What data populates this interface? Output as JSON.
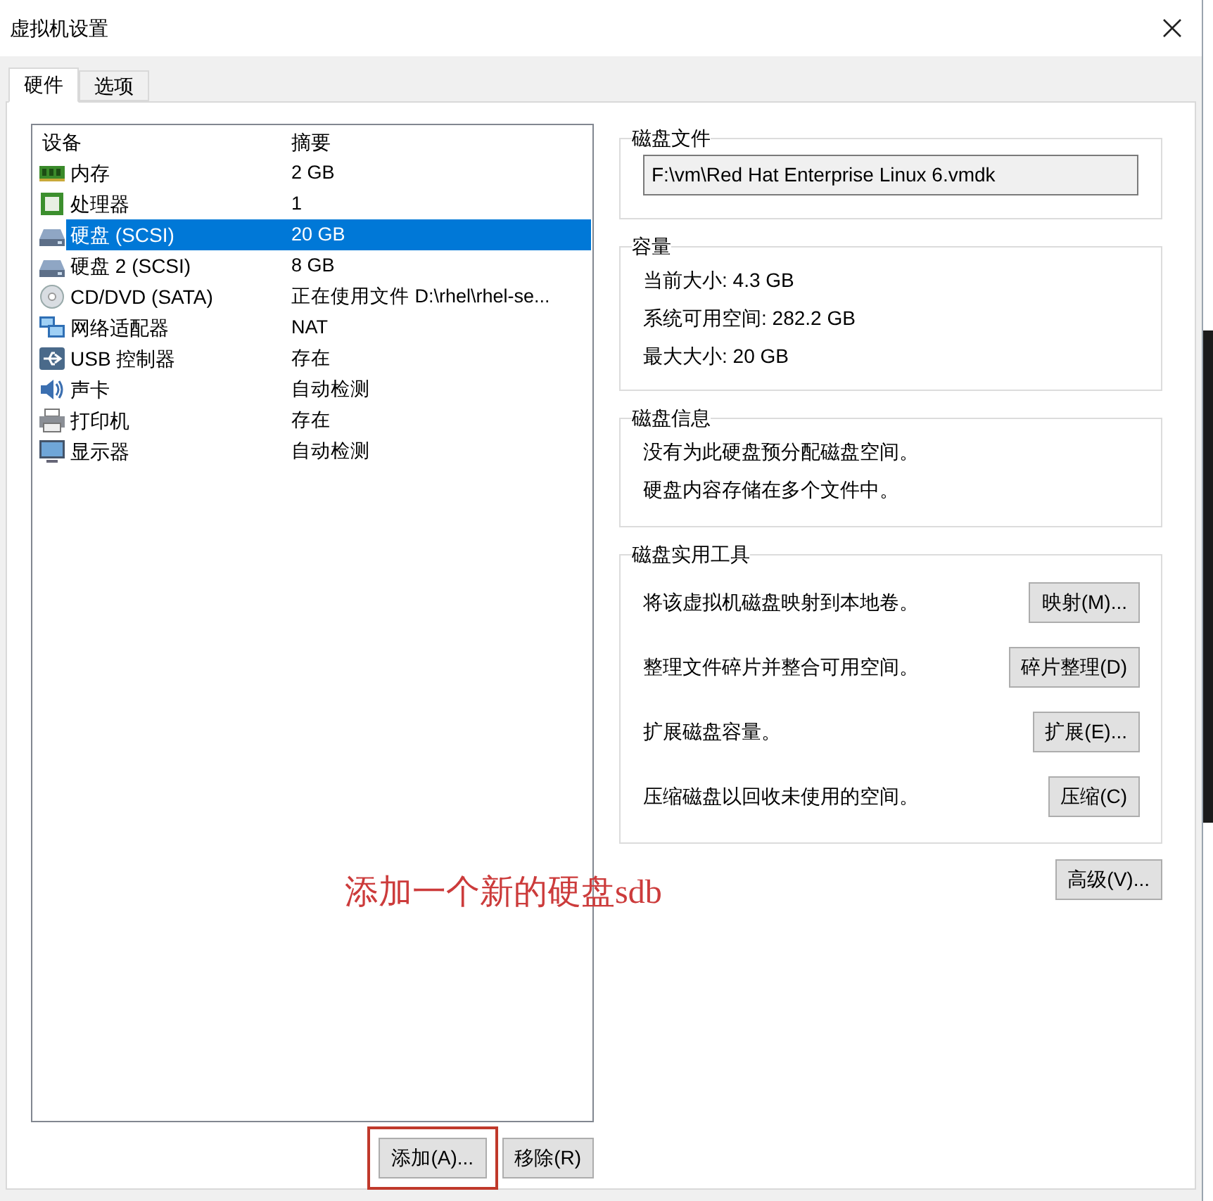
{
  "window": {
    "title": "虚拟机设置"
  },
  "tabs": [
    {
      "label": "硬件",
      "selected": true
    },
    {
      "label": "选项",
      "selected": false
    }
  ],
  "device_table": {
    "columns": [
      "设备",
      "摘要"
    ],
    "rows": [
      {
        "kind": "memory",
        "device": "内存",
        "summary": "2 GB",
        "selected": false
      },
      {
        "kind": "cpu",
        "device": "处理器",
        "summary": "1",
        "selected": false
      },
      {
        "kind": "disk",
        "device": "硬盘 (SCSI)",
        "summary": "20 GB",
        "selected": true
      },
      {
        "kind": "disk",
        "device": "硬盘 2 (SCSI)",
        "summary": "8 GB",
        "selected": false
      },
      {
        "kind": "cdrom",
        "device": "CD/DVD (SATA)",
        "summary": "正在使用文件 D:\\rhel\\rhel-se...",
        "selected": false
      },
      {
        "kind": "network",
        "device": "网络适配器",
        "summary": "NAT",
        "selected": false
      },
      {
        "kind": "usb",
        "device": "USB 控制器",
        "summary": "存在",
        "selected": false
      },
      {
        "kind": "sound",
        "device": "声卡",
        "summary": "自动检测",
        "selected": false
      },
      {
        "kind": "printer",
        "device": "打印机",
        "summary": "存在",
        "selected": false
      },
      {
        "kind": "display",
        "device": "显示器",
        "summary": "自动检测",
        "selected": false
      }
    ]
  },
  "device_buttons": [
    {
      "label": "添加(A)...",
      "highlighted": true
    },
    {
      "label": "移除(R)",
      "highlighted": false
    }
  ],
  "disk_file": {
    "title": "磁盘文件",
    "value": "F:\\vm\\Red Hat Enterprise Linux 6.vmdk"
  },
  "capacity": {
    "title": "容量",
    "lines": [
      "当前大小: 4.3 GB",
      "系统可用空间: 282.2 GB",
      "最大大小: 20 GB"
    ]
  },
  "disk_info": {
    "title": "磁盘信息",
    "lines": [
      "没有为此硬盘预分配磁盘空间。",
      "硬盘内容存储在多个文件中。"
    ]
  },
  "disk_utilities": {
    "title": "磁盘实用工具",
    "items": [
      {
        "text": "将该虚拟机磁盘映射到本地卷。",
        "button": "映射(M)..."
      },
      {
        "text": "整理文件碎片并整合可用空间。",
        "button": "碎片整理(D)"
      },
      {
        "text": "扩展磁盘容量。",
        "button": "扩展(E)..."
      },
      {
        "text": "压缩磁盘以回收未使用的空间。",
        "button": "压缩(C)"
      }
    ]
  },
  "advanced_button": "高级(V)...",
  "annotation": "添加一个新的硬盘sdb"
}
